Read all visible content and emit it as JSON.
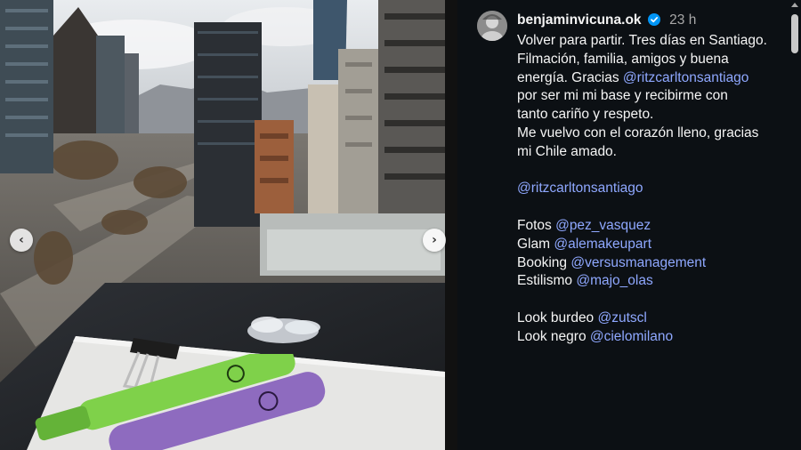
{
  "post": {
    "username": "benjaminvicuna.ok",
    "verified_icon": "verified-badge-icon",
    "time": "23 h",
    "caption_lines": [
      [
        {
          "t": "Volver para partir. Tres días en Santiago."
        }
      ],
      [
        {
          "t": "Filmación, familia,  amigos y buena"
        }
      ],
      [
        {
          "t": "energía. Gracias "
        },
        {
          "t": "@ritzcarltonsantiago",
          "m": true
        }
      ],
      [
        {
          "t": "por ser mi mi base y recibirme con"
        }
      ],
      [
        {
          "t": "tanto cariño y respeto."
        }
      ],
      [
        {
          "t": "Me vuelvo con el corazón lleno, gracias"
        }
      ],
      [
        {
          "t": "mi Chile amado."
        }
      ],
      [],
      [
        {
          "t": "@ritzcarltonsantiago",
          "m": true
        }
      ],
      [],
      [
        {
          "t": "Fotos  "
        },
        {
          "t": "@pez_vasquez",
          "m": true
        }
      ],
      [
        {
          "t": "Glam "
        },
        {
          "t": "@alemakeupart",
          "m": true
        }
      ],
      [
        {
          "t": "Booking "
        },
        {
          "t": "@versusmanagement",
          "m": true
        }
      ],
      [
        {
          "t": "Estilismo "
        },
        {
          "t": "@majo_olas",
          "m": true
        }
      ],
      [],
      [
        {
          "t": "Look burdeo "
        },
        {
          "t": "@zutscl",
          "m": true
        }
      ],
      [
        {
          "t": "Look negro "
        },
        {
          "t": "@cielomilano",
          "m": true
        }
      ]
    ]
  },
  "carousel": {
    "prev_icon": "chevron-left-icon",
    "next_icon": "chevron-right-icon",
    "prev_glyph": "‹",
    "next_glyph": "›"
  },
  "colors": {
    "panel_bg": "#0c1014",
    "mention": "#8fa8ff",
    "verified": "#0095f6",
    "highlighter_green": "#7fd14a",
    "highlighter_purple": "#8e6bbf"
  }
}
